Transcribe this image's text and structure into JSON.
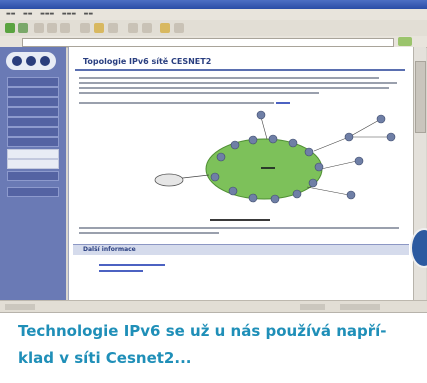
{
  "page": {
    "title": "Topologie IPv6 sítě CESNET2",
    "info_heading": "Další informace"
  },
  "caption": {
    "line1": "Technologie IPv6 se už u nás používá napří-",
    "line2": "klad v síti Cesnet2..."
  },
  "colors": {
    "sidebar": "#6a7ab5",
    "title": "#2a3f80",
    "ellipse": "#7dc15a",
    "node": "#6f7fa6",
    "caption": "#1f8fb8"
  },
  "icons": [
    "back-icon",
    "forward-icon",
    "stop-icon",
    "refresh-icon",
    "home-icon",
    "search-icon",
    "go-icon"
  ]
}
